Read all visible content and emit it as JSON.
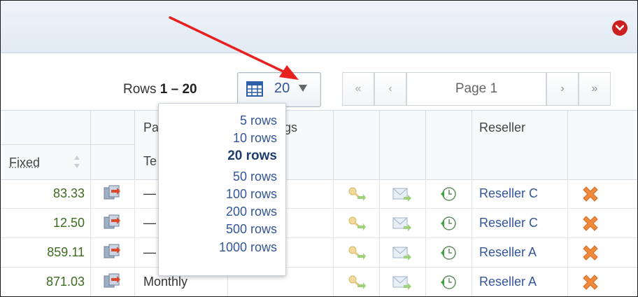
{
  "toolbar": {
    "rows_label": "Rows",
    "rows_range": "1 – 20",
    "rows_per_page_value": "20"
  },
  "pager": {
    "first": "«",
    "prev": "‹",
    "page_label": "Page 1",
    "next": "›",
    "last": "»"
  },
  "rows_dropdown": {
    "options": [
      "5 rows",
      "10 rows",
      "20 rows",
      "50 rows",
      "100 rows",
      "200 rows",
      "500 rows",
      "1000 rows"
    ],
    "selected": "20 rows"
  },
  "table": {
    "headers": {
      "fixed": "Fixed",
      "period_type_partial": "Pa\nTe",
      "settings_partial": "gs",
      "reseller": "Reseller"
    },
    "rows": [
      {
        "fixed": "83.33",
        "period": "—",
        "reseller": "Reseller C"
      },
      {
        "fixed": "12.50",
        "period": "—",
        "reseller": "Reseller C"
      },
      {
        "fixed": "859.11",
        "period": "—",
        "reseller": "Reseller A"
      },
      {
        "fixed": "871.03",
        "period": "Monthly",
        "reseller": "Reseller A"
      }
    ]
  },
  "colors": {
    "accent_blue": "#335599",
    "value_green": "#3d6b1e",
    "annotation_arrow": "#e82020",
    "delete_orange": "#f08a3c"
  }
}
